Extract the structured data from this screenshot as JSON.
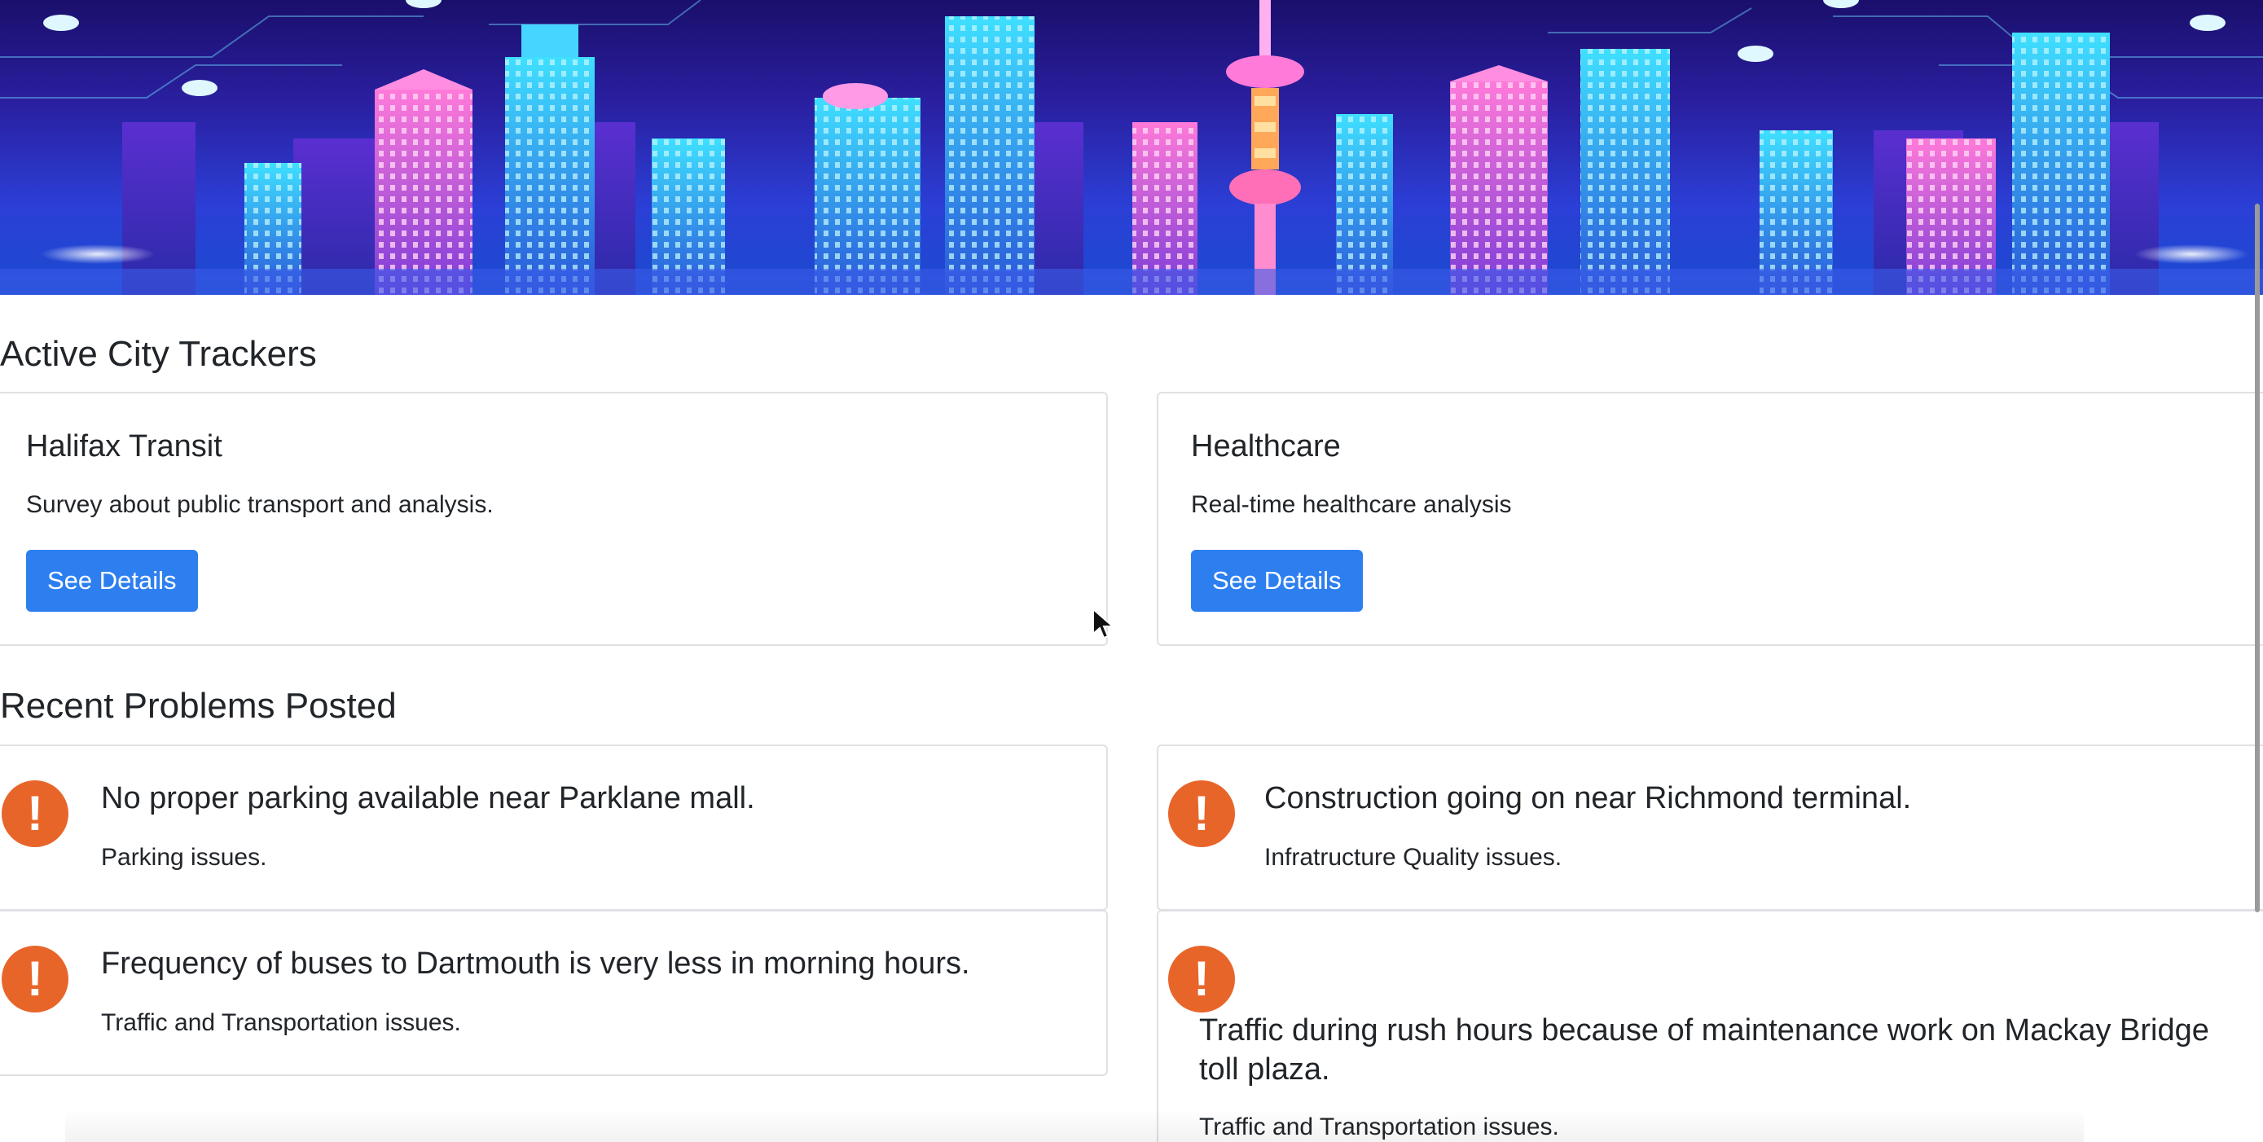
{
  "sections": {
    "trackers_title": "Active City Trackers",
    "problems_title": "Recent Problems Posted"
  },
  "trackers": [
    {
      "title": "Halifax Transit",
      "description": "Survey about public transport and analysis.",
      "button_label": "See Details"
    },
    {
      "title": "Healthcare",
      "description": "Real-time healthcare analysis",
      "button_label": "See Details"
    }
  ],
  "problems": [
    {
      "title": "No proper parking available near Parklane mall.",
      "category": "Parking issues.",
      "icon": "alert-circle-icon"
    },
    {
      "title": "Construction going on near Richmond terminal.",
      "category": "Infratructure Quality issues.",
      "icon": "alert-circle-icon"
    },
    {
      "title": "Frequency of buses to Dartmouth is very less in morning hours.",
      "category": "Traffic and Transportation issues.",
      "icon": "alert-circle-icon"
    },
    {
      "title": "Traffic during rush hours because of maintenance work on Mackay Bridge toll plaza.",
      "category": "Traffic and Transportation issues.",
      "icon": "alert-circle-icon"
    }
  ],
  "colors": {
    "button": "#2d7ff0",
    "alert": "#e8652a",
    "banner_dark": "#1a0f6b",
    "banner_light": "#2b3fd6"
  }
}
